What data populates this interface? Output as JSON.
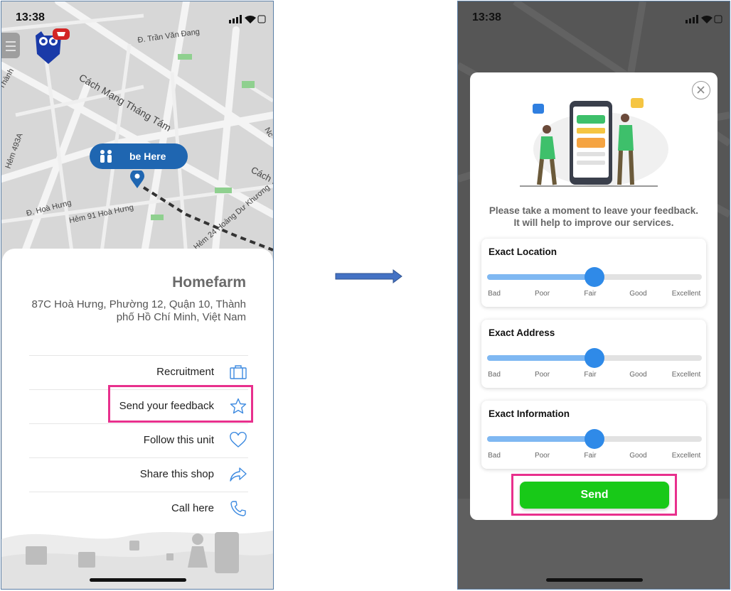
{
  "status_bar": {
    "time": "13:38"
  },
  "map": {
    "streets": [
      "Đ. Trần Văn Đang",
      "Cách Mạng Tháng Tám",
      "Hẻm 91 Hoà Hưng",
      "Đ. Hoà Hưng",
      "Hẻm 24 Hoàng Dư Khương",
      "Hẻm 493A",
      "Cách I",
      "Thành",
      "Nc"
    ],
    "pill_label": "be Here"
  },
  "shop": {
    "name": "Homefarm",
    "address": "87C Hoà Hưng, Phường 12, Quận 10, Thành phố Hồ Chí Minh, Việt Nam",
    "menu": [
      {
        "label": "Recruitment",
        "icon": "briefcase-icon"
      },
      {
        "label": "Send your feedback",
        "icon": "star-icon"
      },
      {
        "label": "Follow this unit",
        "icon": "heart-icon"
      },
      {
        "label": "Share this shop",
        "icon": "share-icon"
      },
      {
        "label": "Call here",
        "icon": "phone-icon"
      }
    ]
  },
  "feedback_modal": {
    "prompt_line1": "Please take a moment to leave your feedback.",
    "prompt_line2": "It will help to improve our services.",
    "scale": [
      "Bad",
      "Poor",
      "Fair",
      "Good",
      "Excellent"
    ],
    "ratings": [
      {
        "title": "Exact Location",
        "value": "Fair",
        "level": 0.5
      },
      {
        "title": "Exact Address",
        "value": "Fair",
        "level": 0.5
      },
      {
        "title": "Exact Information",
        "value": "Fair",
        "level": 0.5
      }
    ],
    "send_label": "Send"
  },
  "colors": {
    "accent_blue": "#1f66b1",
    "slider_thumb": "#2f8ae8",
    "slider_fill": "#7fb8f2",
    "send_green": "#18c918",
    "highlight_pink": "#e8308d",
    "arrow_blue": "#4472c4"
  }
}
